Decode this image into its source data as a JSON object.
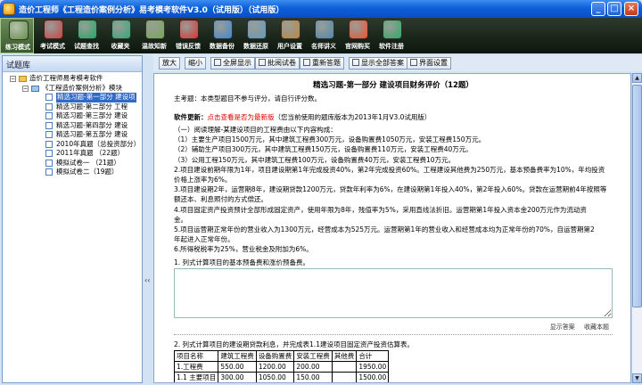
{
  "window": {
    "title": "造价工程师《工程造价案例分析》易考模考软件V3.0（试用版）（试用版）",
    "buttons": [
      "_",
      "□",
      "×"
    ]
  },
  "toolbar": {
    "items": [
      {
        "label": "练习模式",
        "icon": "practice-icon",
        "color": "#6a8f4f",
        "active": true
      },
      {
        "label": "考试模式",
        "icon": "exam-icon",
        "color": "#c44"
      },
      {
        "label": "试题查找",
        "icon": "search-icon",
        "color": "#2a6"
      },
      {
        "label": "收藏夹",
        "icon": "bookmark-icon",
        "color": "#3a7"
      },
      {
        "label": "温故知新",
        "icon": "review-icon",
        "color": "#7a5"
      },
      {
        "label": "错误反馈",
        "icon": "feedback-icon",
        "color": "#d33"
      },
      {
        "label": "数据备份",
        "icon": "backup-icon",
        "color": "#48c"
      },
      {
        "label": "数据还原",
        "icon": "restore-icon",
        "color": "#69b"
      },
      {
        "label": "用户设置",
        "icon": "settings-icon",
        "color": "#b84"
      },
      {
        "label": "名师讲义",
        "icon": "lecture-icon",
        "color": "#58a"
      },
      {
        "label": "官网购买",
        "icon": "buy-icon",
        "color": "#e53"
      },
      {
        "label": "软件注册",
        "icon": "register-icon",
        "color": "#3a6"
      }
    ]
  },
  "left_panel": {
    "title": "试题库",
    "root": "造价工程师易考模考软件",
    "module": "《工程造价案例分析》模块",
    "items": [
      "精选习题-第一部分  建设项",
      "精选习题-第二部分  工程",
      "精选习题-第三部分  建设",
      "精选习题-第四部分  建设",
      "精选习题-第五部分  建设",
      "2010年真题（总投资部分）",
      "2011年真题 （22题）",
      "模拟试卷一 （21题）",
      "模拟试卷二（19题）"
    ]
  },
  "right_toolbar": {
    "buttons": [
      "放大",
      "缩小",
      "全屏显示",
      "批阅试卷",
      "重新答题",
      "显示全部答案",
      "界面设置"
    ]
  },
  "content": {
    "heading": "精选习题-第一部分   建设项目财务评价（12题）",
    "topic": "主考题：本类型题目不参与评分，请自行评分数。",
    "update_label": "软件更新：",
    "update_link": "点击查看是否为最新版",
    "update_note": "（您当前使用的题库版本为2013年1月V3.0试用版）",
    "lines": [
      "（一）阅读理解-某建设项目的工程费由以下内容构成：",
      "（1）主要生产项目1500万元，其中建筑工程费300万元，设备购置费1050万元，安装工程费150万元。",
      "（2）辅助生产项目300万元，其中建筑工程费150万元，设备购置费110万元，安装工程费40万元。",
      "（3）公用工程150万元，其中建筑工程费100万元，设备购置费40万元，安装工程费10万元。",
      "2.项目建设前期年限为1年，项目建设期第1年完成投资40%，第2年完成投资60%。工程建设其他费为250万元，基本预备费率为10%，年均投资",
      "价格上涨率为6%。",
      "3.项目建设期2年，运营期8年，建设期贷款1200万元，贷款年利率为6%，在建设期第1年投入40%，第2年投入60%。贷款在运营期前4年按照等",
      "额还本、利息照付的方式偿还。",
      "4.项目固定资产投资预计全部形成固定资产，使用年限为8年，残值率为5%，采用直线法折旧。运营期第1年投入资本金200万元作为流动资",
      "金。",
      "5.项目运营期正常年份的营业收入为1300万元，经营成本为525万元。运营期第1年的营业收入和经营成本均为正常年份的70%，自运营期第2",
      "年起进入正常年份。",
      "6.所得税税率为25%，营业税金及附加为6%。"
    ],
    "question1": "1.  列式计算项目的基本预备费和涨价预备费。",
    "show_answer": "显示答案",
    "bookmark": "收藏本题",
    "question2": "2.  列式计算项目的建设期贷款利息，并完成表1.1建设项目固定资产投资估算表。",
    "table": {
      "headers": [
        "项目名称",
        "建筑工程费",
        "设备购置费",
        "安装工程费",
        "其他费",
        "合计"
      ],
      "rows": [
        [
          "1.工程费",
          "550.00",
          "1200.00",
          "200.00",
          "",
          "1950.00"
        ],
        [
          "1.1 主要项目",
          "300.00",
          "1050.00",
          "150.00",
          "",
          "1500.00"
        ]
      ]
    }
  }
}
